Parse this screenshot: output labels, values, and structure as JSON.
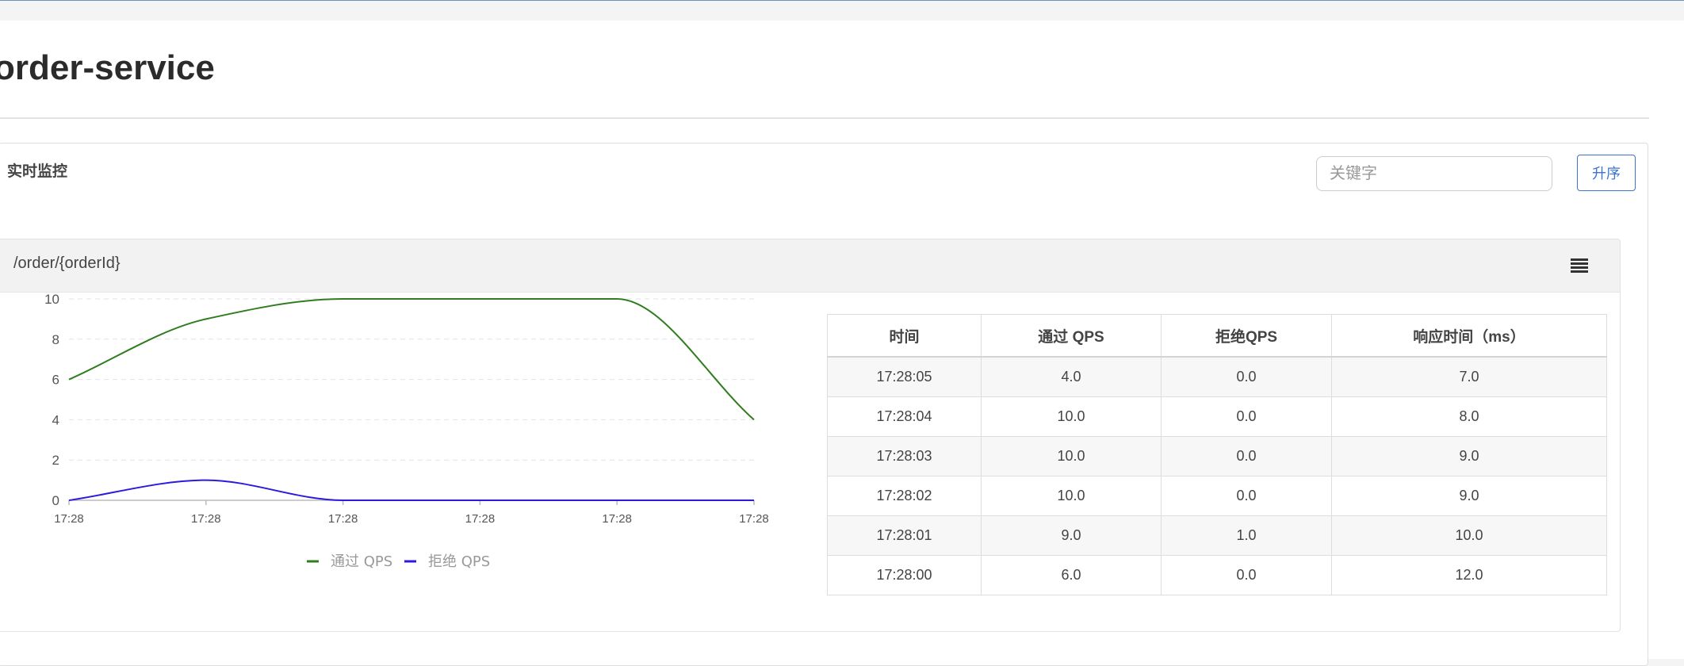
{
  "page": {
    "title": "order-service"
  },
  "panel": {
    "title": "实时监控",
    "search_placeholder": "关键字",
    "sort_label": "升序"
  },
  "resource": {
    "name": "/order/{orderId}"
  },
  "table": {
    "headers": [
      "时间",
      "通过 QPS",
      "拒绝QPS",
      "响应时间（ms）"
    ],
    "rows": [
      [
        "17:28:05",
        "4.0",
        "0.0",
        "7.0"
      ],
      [
        "17:28:04",
        "10.0",
        "0.0",
        "8.0"
      ],
      [
        "17:28:03",
        "10.0",
        "0.0",
        "9.0"
      ],
      [
        "17:28:02",
        "10.0",
        "0.0",
        "9.0"
      ],
      [
        "17:28:01",
        "9.0",
        "1.0",
        "10.0"
      ],
      [
        "17:28:00",
        "6.0",
        "0.0",
        "12.0"
      ]
    ]
  },
  "chart_data": {
    "type": "line",
    "x": [
      "17:28",
      "17:28",
      "17:28",
      "17:28",
      "17:28",
      "17:28"
    ],
    "series": [
      {
        "name": "通过 QPS",
        "values": [
          6,
          9,
          10,
          10,
          10,
          4
        ],
        "color": "#2f7d1e"
      },
      {
        "name": "拒绝 QPS",
        "values": [
          0,
          1,
          0,
          0,
          0,
          0
        ],
        "color": "#2b1ae0"
      }
    ],
    "y_ticks": [
      0,
      2,
      4,
      6,
      8,
      10
    ],
    "ylim": [
      0,
      10
    ],
    "grid": true,
    "legend_position": "bottom-center"
  }
}
